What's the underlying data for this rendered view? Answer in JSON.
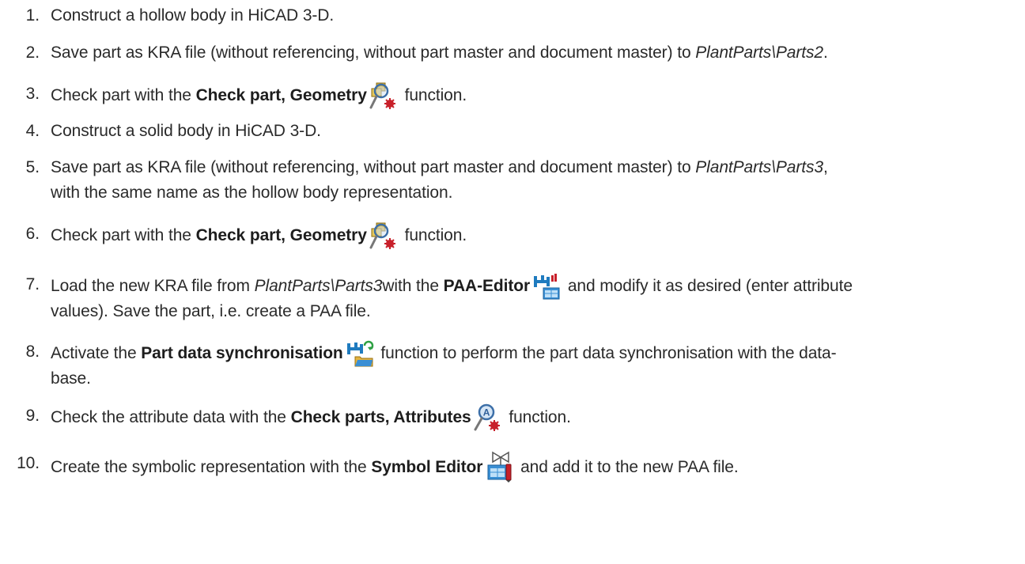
{
  "steps": [
    {
      "number": "1.",
      "text": "Construct a hollow body in HiCAD 3-D."
    },
    {
      "number": "2.",
      "text_before": "Save part as KRA file (without referencing, without part master and document master) to ",
      "path": "PlantParts\\Parts2",
      "text_after": "."
    },
    {
      "number": "3.",
      "text_before": "Check part with the ",
      "function": "Check part, Geometry",
      "icon": "check-part-geometry-icon",
      "text_after": " function."
    },
    {
      "number": "4.",
      "text": "Construct a solid body in HiCAD 3-D."
    },
    {
      "number": "5.",
      "text_before": "Save part as KRA file (without referencing, without part master and document master) to ",
      "path": "PlantParts\\Parts3",
      "text_after": ",",
      "line2": "with the same name as the hollow body representation."
    },
    {
      "number": "6.",
      "text_before": "Check part with the ",
      "function": "Check part, Geometry",
      "icon": "check-part-geometry-icon",
      "text_after": " function."
    },
    {
      "number": "7.",
      "text_before": "Load the new KRA file from ",
      "path": "PlantParts\\Parts3",
      "text_mid": "with the ",
      "function": "PAA-Editor",
      "icon": "paa-editor-icon",
      "text_after": " and modify it as desired (enter attribute",
      "line2": "values). Save the part, i.e. create a PAA file."
    },
    {
      "number": "8.",
      "text_before": "Activate the ",
      "function": "Part data synchronisation",
      "icon": "part-data-synchronisation-icon",
      "text_after": " function to perform the part data synchronisation with the data-",
      "line2": "base."
    },
    {
      "number": "9.",
      "text_before": "Check the attribute data with the ",
      "function": "Check parts, Attributes",
      "icon": "check-parts-attributes-icon",
      "text_after": " function."
    },
    {
      "number": "10.",
      "text_before": "Create the symbolic representation with the ",
      "function": "Symbol Editor",
      "icon": "symbol-editor-icon",
      "text_after": " and add it to the new PAA file."
    }
  ],
  "colors": {
    "text": "#2a2a2a",
    "background": "#ffffff"
  }
}
